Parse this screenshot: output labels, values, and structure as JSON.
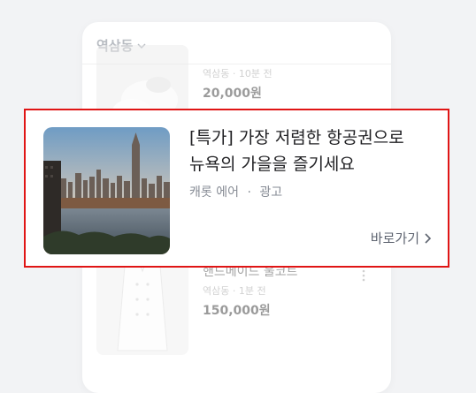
{
  "header": {
    "location": "역삼동"
  },
  "listings": [
    {
      "meta": "역삼동 · 10분 전",
      "price": "20,000원"
    },
    {
      "title": "핸드메이드 울코트",
      "meta": "역삼동 · 1분 전",
      "price": "150,000원"
    }
  ],
  "ad": {
    "title_line1": "[특가] 가장 저렴한 항공권으로",
    "title_line2": "뉴욕의 가을을 즐기세요",
    "advertiser": "캐롯 에어",
    "separator": "·",
    "ad_label": "광고",
    "cta_label": "바로가기"
  },
  "colors": {
    "highlight_border": "#e01515",
    "title": "#212124",
    "muted": "#868b94"
  },
  "icons": {
    "location_dropdown": "chevron-down-icon",
    "cta": "chevron-right-icon",
    "listing_more": "more-vertical-icon"
  }
}
